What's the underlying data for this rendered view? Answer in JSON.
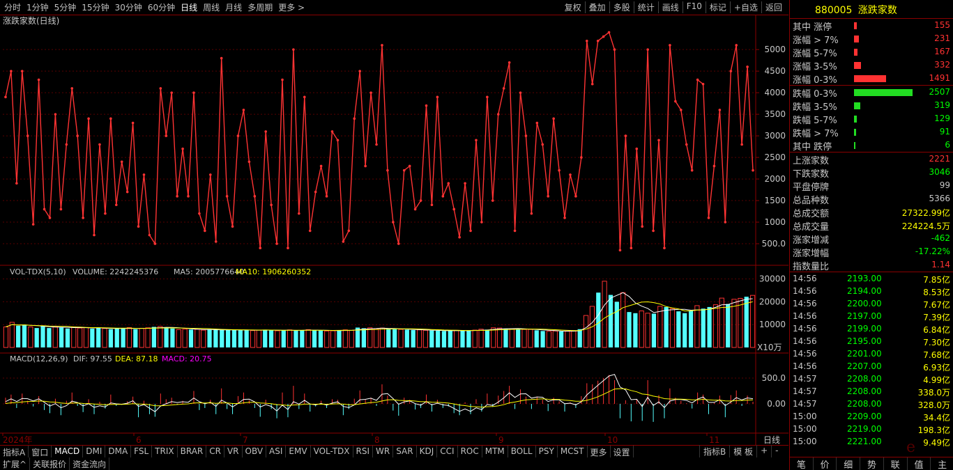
{
  "toolbar": {
    "periods": [
      "分时",
      "1分钟",
      "5分钟",
      "15分钟",
      "30分钟",
      "60分钟",
      "日线",
      "周线",
      "月线",
      "多周期",
      "更多 >"
    ],
    "active_period": "日线",
    "tools": [
      "复权",
      "叠加",
      "多股",
      "统计",
      "画线",
      "F10",
      "标记",
      "+自选",
      "返回"
    ]
  },
  "main_chart": {
    "title": "涨跌家数(日线)",
    "line_color": "#ff3333",
    "y_axis": {
      "min": 0,
      "max": 5600,
      "ticks": [
        500,
        1000,
        1500,
        2000,
        2500,
        3000,
        3500,
        4000,
        4500,
        5000
      ],
      "tick_labels": [
        "500.0",
        "1000",
        "1500",
        "2000",
        "2500",
        "3000",
        "3500",
        "4000",
        "4500",
        "5000"
      ]
    }
  },
  "volume_chart": {
    "label_name": "VOL-TDX(5,10)",
    "label_volume": "VOLUME: 2242245376",
    "label_ma5": "MA5: 2005776640",
    "label_ma10": "MA10: 1906260352",
    "y_ticks": [
      10000,
      20000,
      30000
    ],
    "y_tick_labels": [
      "10000",
      "20000",
      "30000"
    ],
    "unit_label": "X10万"
  },
  "macd_chart": {
    "label_name": "MACD(12,26,9)",
    "label_dif": "DIF: 97.55",
    "label_dea": "DEA: 87.18",
    "label_macd": "MACD: 20.75",
    "y_ticks": [
      0,
      500
    ],
    "y_tick_labels": [
      "0.00",
      "500.0"
    ]
  },
  "x_axis": {
    "labels": [
      "2024年",
      "6",
      "7",
      "8",
      "9",
      "10",
      "11"
    ],
    "right_label": "日线"
  },
  "chart_data": [
    {
      "type": "line",
      "title": "涨跌家数(日线)",
      "series": [
        {
          "values": [
            3900,
            4500,
            1900,
            4500,
            3000,
            950,
            4300,
            1300,
            1100,
            3500,
            1300,
            2800,
            4100,
            3000,
            1100,
            3400,
            700,
            2800,
            1200,
            3400,
            1400,
            2400,
            1700,
            3300,
            900,
            2100,
            700,
            500,
            4100,
            3000,
            4000,
            1600,
            2700,
            1600,
            4000,
            1200,
            800,
            2100,
            550,
            4800,
            1600,
            900,
            3000,
            3600,
            2400,
            1600,
            400,
            3100,
            1400,
            500,
            4300,
            400,
            5000,
            1200,
            3900,
            800,
            1700,
            2300,
            1600,
            3100,
            2900,
            550,
            800,
            3400,
            4500,
            2300,
            4000,
            2800,
            5100,
            2200,
            1000,
            500,
            2200,
            2300,
            1300,
            1500,
            3700,
            1400,
            3900,
            1600,
            1900,
            1300,
            650,
            1900,
            800,
            2900,
            1000,
            3900,
            1500,
            3500,
            4100,
            4700,
            800,
            4000,
            3000,
            1200,
            3300,
            2800,
            1600,
            3400,
            2200,
            1100,
            2100,
            1600,
            2500,
            5200,
            4200,
            5200,
            5300,
            5400,
            5000,
            350,
            3000,
            400,
            2700,
            900,
            5000,
            800,
            2900,
            400,
            5100,
            3800,
            3600,
            2800,
            2200,
            4300,
            4200,
            1100,
            2300,
            3600,
            1000,
            4500,
            5100,
            2800,
            4600,
            2200
          ]
        }
      ],
      "ylim": [
        0,
        5600
      ]
    },
    {
      "type": "bar",
      "title": "VOL-TDX(5,10)",
      "unit": "X10万",
      "values": [
        9000,
        11000,
        9500,
        10000,
        9000,
        8500,
        9500,
        8500,
        9000,
        8700,
        8300,
        9000,
        8500,
        8700,
        8200,
        8600,
        8300,
        8000,
        8500,
        8200,
        8700,
        8000,
        8400,
        8600,
        9000,
        9200,
        8800,
        8300,
        7800,
        8000,
        7800,
        7900,
        7600,
        7800,
        7700,
        7600,
        7800,
        7600,
        7500,
        7700,
        7400,
        7600,
        7800,
        7500,
        7300,
        7500,
        7700,
        7400,
        7600,
        7800,
        7500,
        7400,
        7200,
        7300,
        7600,
        7700,
        7500,
        8700,
        8400,
        8600,
        8200,
        8500,
        8100,
        8000,
        7900,
        7800,
        7600,
        7700,
        7500,
        7400,
        7300,
        7200,
        7400,
        7500,
        7300,
        7400,
        7600,
        8000,
        7800,
        8600,
        8500,
        8100,
        8200,
        8000,
        7900,
        7900,
        7500,
        7200,
        7100,
        7200,
        7000,
        7100,
        7200,
        8000,
        14000,
        18000,
        24000,
        29000,
        23000,
        20000,
        24000,
        15500,
        15000,
        16000,
        15000,
        14800,
        18000,
        17700,
        17000,
        15800,
        15000,
        16000,
        18300,
        17000,
        17700,
        18700,
        21600,
        19000,
        21100,
        21500,
        22200,
        22800
      ],
      "colors": [
        "#ff3232",
        "#54ffff"
      ],
      "ma5_color": "#ffffff",
      "ma10_color": "#ffff00"
    },
    {
      "type": "bar",
      "title": "MACD(12,26,9)",
      "values": [
        120,
        180,
        -80,
        200,
        60,
        -50,
        150,
        -120,
        -180,
        100,
        -220,
        60,
        220,
        -40,
        -160,
        90,
        -200,
        40,
        -90,
        180,
        -40,
        -20,
        50,
        140,
        -260,
        60,
        -200,
        -250,
        200,
        90,
        120,
        -20,
        60,
        0,
        250,
        -120,
        -80,
        80,
        -200,
        300,
        -100,
        -200,
        150,
        220,
        70,
        -80,
        -250,
        80,
        -100,
        -280,
        220,
        -260,
        350,
        -100,
        200,
        -150,
        -50,
        60,
        -80,
        90,
        80,
        -220,
        -100,
        100,
        260,
        80,
        120,
        -40,
        380,
        160,
        -130,
        -230,
        120,
        80,
        -110,
        -80,
        180,
        -150,
        80,
        -80,
        -50,
        -180,
        -220,
        30,
        -200,
        90,
        -150,
        200,
        -60,
        160,
        250,
        350,
        -100,
        280,
        140,
        -100,
        140,
        80,
        -140,
        120,
        50,
        -150,
        30,
        -80,
        150,
        400,
        380,
        450,
        500,
        560,
        460,
        -280,
        70,
        -340,
        80,
        -330,
        460,
        -350,
        170,
        -280,
        300,
        120,
        60,
        10,
        -90,
        220,
        180,
        -200,
        20,
        160,
        -260,
        170,
        260,
        -40,
        160,
        40
      ],
      "dif_color": "#ffffff",
      "dea_color": "#ffff00"
    }
  ],
  "right_panel": {
    "code": "880005",
    "name": "涨跌家数",
    "up_rows": [
      {
        "label": "其中 涨停",
        "value": "155",
        "bar": 0.05
      },
      {
        "label": "涨幅 > 7%",
        "value": "231",
        "bar": 0.08
      },
      {
        "label": "涨幅 5-7%",
        "value": "167",
        "bar": 0.06
      },
      {
        "label": "涨幅 3-5%",
        "value": "332",
        "bar": 0.12
      },
      {
        "label": "涨幅 0-3%",
        "value": "1491",
        "bar": 0.55
      }
    ],
    "down_rows": [
      {
        "label": "跌幅 0-3%",
        "value": "2507",
        "bar": 1.0
      },
      {
        "label": "跌幅 3-5%",
        "value": "319",
        "bar": 0.11
      },
      {
        "label": "跌幅 5-7%",
        "value": "129",
        "bar": 0.05
      },
      {
        "label": "跌幅 > 7%",
        "value": "91",
        "bar": 0.03
      },
      {
        "label": "其中 跌停",
        "value": "6",
        "bar": 0.01
      }
    ],
    "stats": [
      {
        "label": "上涨家数",
        "value": "2221",
        "color": "#ff3232"
      },
      {
        "label": "下跌家数",
        "value": "3046",
        "color": "#00ff00"
      },
      {
        "label": "平盘停牌",
        "value": "99",
        "color": "#c8c8c8"
      },
      {
        "label": "总品种数",
        "value": "5366",
        "color": "#c8c8c8"
      },
      {
        "label": "总成交额",
        "value": "27322.99亿",
        "color": "#ffff00"
      },
      {
        "label": "总成交量",
        "value": "224224.5万",
        "color": "#ffff00"
      },
      {
        "label": "涨家增减",
        "value": "-462",
        "color": "#00ff00"
      },
      {
        "label": "涨家增幅",
        "value": "-17.22%",
        "color": "#00ff00"
      },
      {
        "label": "指数量比",
        "value": "1.14",
        "color": "#ff3232"
      }
    ],
    "ticks": [
      {
        "time": "14:56",
        "price": "2193.00",
        "amount": "7.85亿"
      },
      {
        "time": "14:56",
        "price": "2194.00",
        "amount": "8.53亿"
      },
      {
        "time": "14:56",
        "price": "2200.00",
        "amount": "7.67亿"
      },
      {
        "time": "14:56",
        "price": "2197.00",
        "amount": "7.39亿"
      },
      {
        "time": "14:56",
        "price": "2199.00",
        "amount": "6.84亿"
      },
      {
        "time": "14:56",
        "price": "2195.00",
        "amount": "7.30亿"
      },
      {
        "time": "14:56",
        "price": "2201.00",
        "amount": "7.68亿"
      },
      {
        "time": "14:56",
        "price": "2207.00",
        "amount": "6.93亿"
      },
      {
        "time": "14:57",
        "price": "2208.00",
        "amount": "4.99亿"
      },
      {
        "time": "14:57",
        "price": "2208.00",
        "amount": "338.0万"
      },
      {
        "time": "14:57",
        "price": "2208.00",
        "amount": "328.0万"
      },
      {
        "time": "15:00",
        "price": "2209.00",
        "amount": "34.4亿"
      },
      {
        "time": "15:00",
        "price": "2219.00",
        "amount": "198.3亿"
      },
      {
        "time": "15:00",
        "price": "2221.00",
        "amount": "9.49亿"
      }
    ],
    "bottom_tabs": [
      "笔",
      "价",
      "细",
      "势",
      "联",
      "值",
      "主"
    ]
  },
  "indicator_tabs": [
    "指标A",
    "窗口",
    "MACD",
    "DMI",
    "DMA",
    "FSL",
    "TRIX",
    "BRAR",
    "CR",
    "VR",
    "OBV",
    "ASI",
    "EMV",
    "VOL-TDX",
    "RSI",
    "WR",
    "SAR",
    "KDJ",
    "CCI",
    "ROC",
    "MTM",
    "BOLL",
    "PSY",
    "MCST",
    "更多",
    "设置"
  ],
  "active_indicator": "MACD",
  "indicator_right": [
    "指标B",
    "模 板",
    "+",
    "-"
  ],
  "bottom_tabs": [
    "扩展^",
    "关联报价",
    "资金流向"
  ],
  "watermark": "e"
}
